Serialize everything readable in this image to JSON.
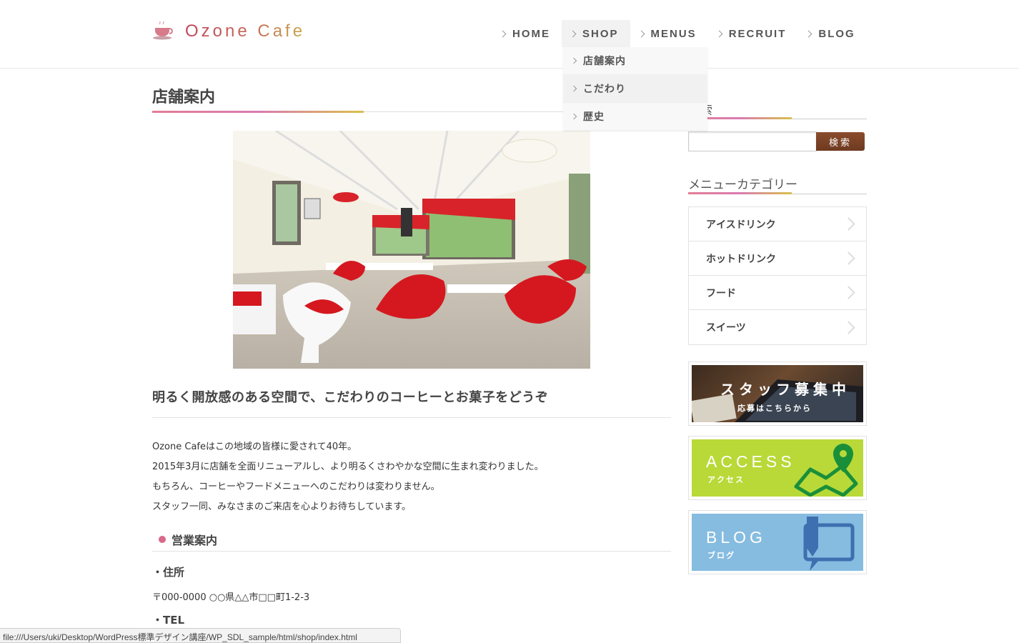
{
  "header": {
    "logo_text": "Ozone Cafe",
    "nav": [
      {
        "label": "HOME"
      },
      {
        "label": "SHOP"
      },
      {
        "label": "MENUS"
      },
      {
        "label": "RECRUIT"
      },
      {
        "label": "BLOG"
      }
    ],
    "dropdown": [
      {
        "label": "店舗案内"
      },
      {
        "label": "こだわり"
      },
      {
        "label": "歴史"
      }
    ]
  },
  "main": {
    "title": "店舗案内",
    "lead": "明るく開放感のある空間で、こだわりのコーヒーとお菓子をどうぞ",
    "paragraphs": [
      "Ozone Cafeはこの地域の皆様に愛されて40年。",
      "2015年3月に店舗を全面リニューアルし、より明るくさわやかな空間に生まれ変わりました。",
      "もちろん、コーヒーやフードメニューへのこだわりは変わりません。",
      "スタッフ一同、みなさまのご来店を心よりお待ちしています。"
    ],
    "section_heading": "営業案内",
    "address_label": "・住所",
    "address_value": "〒000-0000 ○○県△△市□□町1-2-3",
    "tel_label": "・TEL"
  },
  "sidebar": {
    "search_title": "検索",
    "search_button": "検索",
    "search_value": "",
    "category_title": "メニューカテゴリー",
    "categories": [
      {
        "label": "アイスドリンク"
      },
      {
        "label": "ホットドリンク"
      },
      {
        "label": "フード"
      },
      {
        "label": "スイーツ"
      }
    ],
    "banners": {
      "staff_main": "スタッフ募集中",
      "staff_sub": "応募はこちらから",
      "access_main": "ACCESS",
      "access_sub": "アクセス",
      "blog_main": "BLOG",
      "blog_sub": "ブログ"
    }
  },
  "status_url": "file:///Users/uki/Desktop/WordPress標準デザイン講座/WP_SDL_sample/html/shop/index.html",
  "colors": {
    "accent_pink": "#d9688a",
    "logo": "#c0455a",
    "search_button": "#7a4224",
    "access_green": "#b8d938",
    "blog_blue": "#86bce0"
  }
}
